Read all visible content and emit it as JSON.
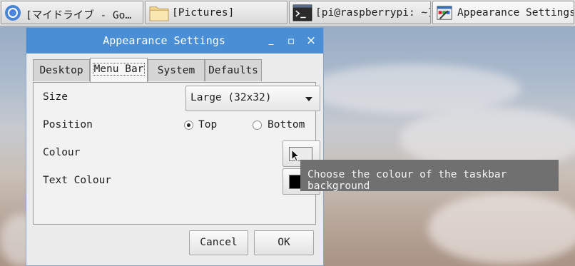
{
  "taskbar": {
    "items": [
      {
        "label": "[マイドライブ - Go…",
        "icon": "chromium-icon"
      },
      {
        "label": "[Pictures]",
        "icon": "folder-icon"
      },
      {
        "label": "[pi@raspberrypi: ~]",
        "icon": "terminal-icon"
      },
      {
        "label": "Appearance Settings",
        "icon": "appearance-settings-icon"
      }
    ]
  },
  "window": {
    "title": "Appearance Settings",
    "minimize": "_",
    "maximize": "▫",
    "close": "×",
    "tabs": [
      {
        "label": "Desktop"
      },
      {
        "label": "Menu Bar",
        "selected": true
      },
      {
        "label": "System"
      },
      {
        "label": "Defaults"
      }
    ],
    "menubar": {
      "size_label": "Size",
      "size_value": "Large (32x32)",
      "position_label": "Position",
      "position_options": [
        {
          "label": "Top",
          "checked": true
        },
        {
          "label": "Bottom",
          "checked": false
        }
      ],
      "colour_label": "Colour",
      "colour_value": "#ececec",
      "text_colour_label": "Text Colour",
      "text_colour_value": "#000000"
    },
    "buttons": {
      "cancel": "Cancel",
      "ok": "OK"
    }
  },
  "tooltip": "Choose the colour of the taskbar background",
  "colors": {
    "titlebar": "#4a8fd6",
    "tooltip_bg": "#707070"
  }
}
